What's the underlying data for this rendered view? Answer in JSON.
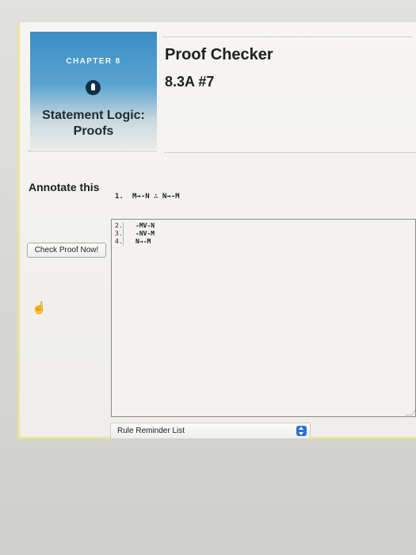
{
  "header": {
    "chapter_label": "CHAPTER 8",
    "chapter_title": "Statement Logic: Proofs",
    "page_title": "Proof Checker",
    "exercise_id": "8.3A #7"
  },
  "icons": {
    "chapter_icon": "lightbulb-icon",
    "cursor_icon": "hand-pointer-icon",
    "select_arrow_icon": "updown-chevron-icon"
  },
  "colors": {
    "card_blue": "#3a8ec4",
    "panel_border": "#e8e59a",
    "select_arrow": "#2c6fd8"
  },
  "annotate": {
    "label": "Annotate this"
  },
  "premise": {
    "number": "1.",
    "text": "M→-N ∴ N→-M"
  },
  "proof": {
    "lines": [
      {
        "number": "2.",
        "text": "-MV-N"
      },
      {
        "number": "3.",
        "text": "-NV-M"
      },
      {
        "number": "4.",
        "text": "N→-M"
      }
    ]
  },
  "actions": {
    "check_label": "Check Proof Now!"
  },
  "rules": {
    "selected": "Rule Reminder List"
  }
}
